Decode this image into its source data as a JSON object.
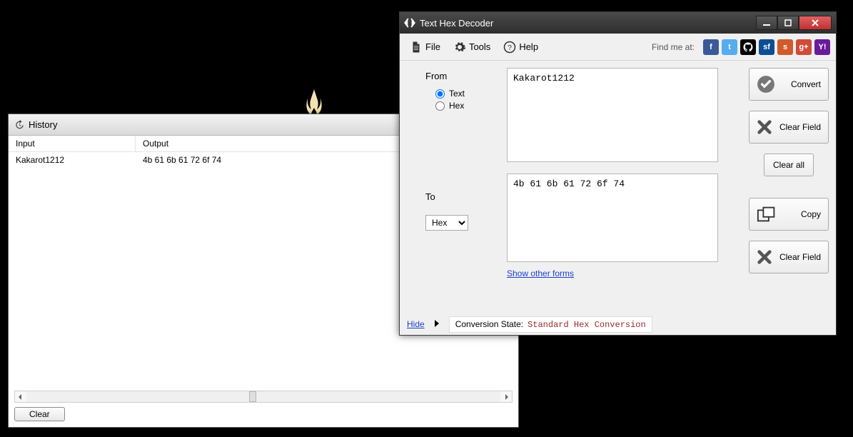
{
  "history_window": {
    "title": "History",
    "columns": {
      "input": "Input",
      "output": "Output"
    },
    "rows": [
      {
        "input": "Kakarot1212",
        "output": "4b 61 6b 61 72 6f 74"
      }
    ],
    "clear_button": "Clear"
  },
  "decoder_window": {
    "title": "Text Hex Decoder",
    "menu": {
      "file": "File",
      "tools": "Tools",
      "help": "Help",
      "find_me": "Find me at:"
    },
    "social": [
      {
        "name": "facebook",
        "bg": "#3b5998",
        "glyph": "f"
      },
      {
        "name": "twitter",
        "bg": "#55acee",
        "glyph": "t"
      },
      {
        "name": "github",
        "bg": "#000000",
        "glyph": "gh"
      },
      {
        "name": "sourceforge",
        "bg": "#0b4f91",
        "glyph": "sf"
      },
      {
        "name": "stackoverflow",
        "bg": "#d15a2b",
        "glyph": "s"
      },
      {
        "name": "googleplus",
        "bg": "#d04b39",
        "glyph": "g+"
      },
      {
        "name": "yahoo",
        "bg": "#6b1b9a",
        "glyph": "Y!"
      }
    ],
    "from": {
      "label": "From",
      "options": {
        "text": "Text",
        "hex": "Hex"
      },
      "selected": "text",
      "value": "Kakarot1212"
    },
    "to": {
      "label": "To",
      "selected": "Hex",
      "value": "4b 61 6b 61 72 6f 74",
      "show_other_forms": "Show other forms"
    },
    "buttons": {
      "convert": "Convert",
      "clear_field_top": "Clear Field",
      "clear_all": "Clear all",
      "copy": "Copy",
      "clear_field_bottom": "Clear Field"
    },
    "status": {
      "hide": "Hide",
      "label": "Conversion State:",
      "value": "Standard Hex Conversion"
    }
  }
}
